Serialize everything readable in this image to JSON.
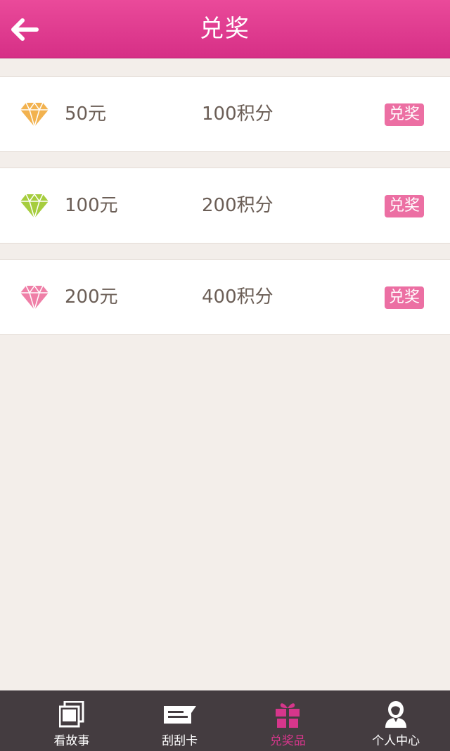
{
  "header": {
    "title": "兑奖",
    "back_icon": "arrow-left-icon"
  },
  "prizes": [
    {
      "amount": "50元",
      "points": "100积分",
      "button": "兑奖",
      "gem_color": "#f2b24f"
    },
    {
      "amount": "100元",
      "points": "200积分",
      "button": "兑奖",
      "gem_color": "#a6cd3e"
    },
    {
      "amount": "200元",
      "points": "400积分",
      "button": "兑奖",
      "gem_color": "#ef7fa7"
    }
  ],
  "tabbar": {
    "items": [
      {
        "label": "看故事",
        "icon": "photo-stack-icon"
      },
      {
        "label": "刮刮卡",
        "icon": "card-icon"
      },
      {
        "label": "兑奖品",
        "icon": "gift-icon",
        "active": true
      },
      {
        "label": "个人中心",
        "icon": "user-icon"
      }
    ]
  },
  "colors": {
    "header": "#e0378d",
    "accent": "#d6368b",
    "button": "#ec6fa3",
    "tabbar": "#443c40",
    "background": "#f3eeea"
  }
}
